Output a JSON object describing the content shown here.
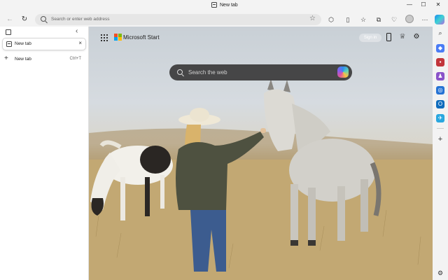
{
  "window": {
    "title": "New tab",
    "controls": {
      "minimize": "—",
      "maximize": "☐",
      "close": "✕"
    }
  },
  "toolbar": {
    "back": "←",
    "refresh": "↻",
    "address_placeholder": "Search or enter web address",
    "favorite": "☆",
    "more": "···"
  },
  "vertical_tabs": {
    "collapse": "‹",
    "tabs": [
      {
        "label": "New tab",
        "close": "×"
      }
    ],
    "new_tab": {
      "label": "New tab",
      "shortcut": "Ctrl+T",
      "icon": "+"
    }
  },
  "page": {
    "brand": "Microsoft Start",
    "signin": "Sign in",
    "search_placeholder": "Search the web"
  },
  "rail": {
    "add": "+",
    "settings": "⚙"
  },
  "colors": {
    "brand_red": "#f25022",
    "brand_green": "#7fba00",
    "brand_blue": "#00a4ef",
    "brand_yellow": "#ffb900"
  }
}
